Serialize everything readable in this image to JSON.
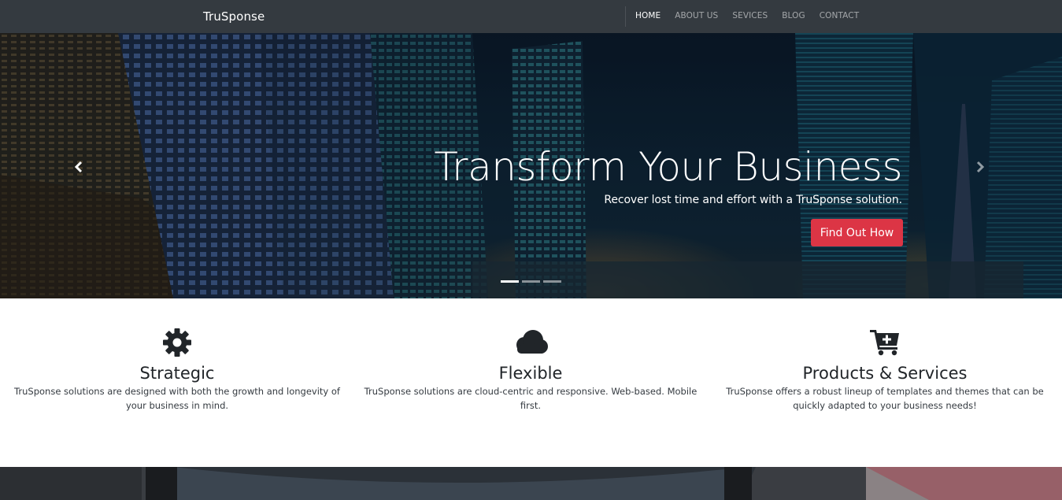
{
  "navbar": {
    "brand": "TruSponse",
    "links": [
      {
        "label": "HOME",
        "active": true
      },
      {
        "label": "ABOUT US",
        "active": false
      },
      {
        "label": "SEVICES",
        "active": false
      },
      {
        "label": "BLOG",
        "active": false
      },
      {
        "label": "CONTACT",
        "active": false
      }
    ]
  },
  "hero": {
    "title": "Transform Your Business",
    "subtitle": "Recover lost time and effort with a TruSponse solution.",
    "cta_label": "Find Out How",
    "slide_count": 3,
    "active_slide": 1,
    "colors": {
      "cta": "#dc3545"
    }
  },
  "features": [
    {
      "icon": "gear-icon",
      "title": "Strategic",
      "text": "TruSponse solutions are designed with both the growth and longevity of your business in mind."
    },
    {
      "icon": "cloud-icon",
      "title": "Flexible",
      "text": "TruSponse solutions are cloud-centric and responsive. Web-based. Mobile first."
    },
    {
      "icon": "cart-plus-icon",
      "title": "Products & Services",
      "text": "TruSponse offers a robust lineup of templates and themes that can be quickly adapted to your business needs!"
    }
  ],
  "colors": {
    "navbar_bg": "#343a40",
    "text_dark": "#212529"
  }
}
